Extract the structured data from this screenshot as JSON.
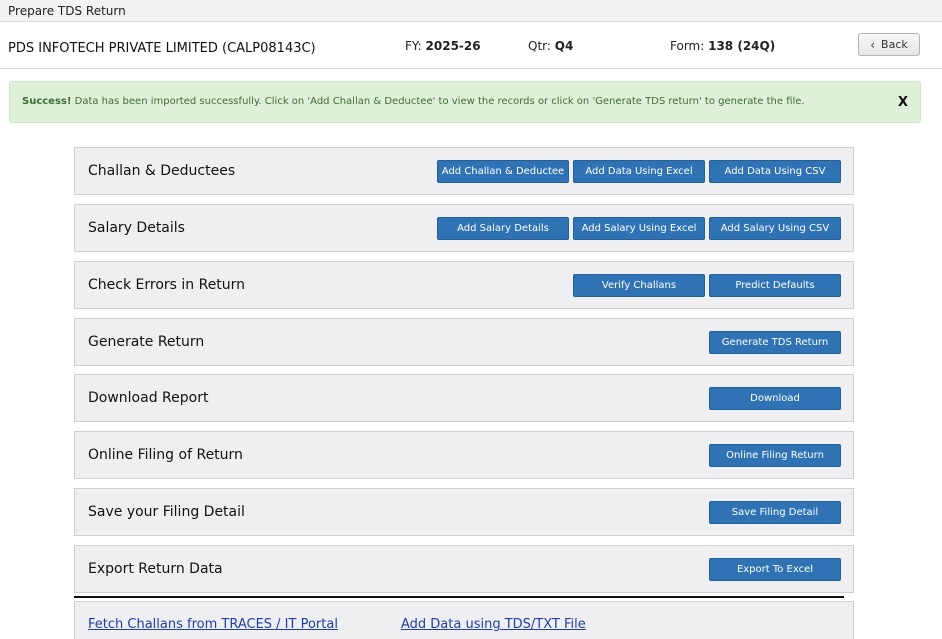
{
  "window": {
    "title": "Prepare TDS Return"
  },
  "header": {
    "company": "PDS INFOTECH PRIVATE LIMITED (CALP08143C)",
    "fy_label": "FY:",
    "fy_value": "2025-26",
    "qtr_label": "Qtr:",
    "qtr_value": "Q4",
    "form_label": "Form:",
    "form_value": "138 (24Q)",
    "back_label": "Back"
  },
  "alert": {
    "strong": "Success!",
    "message": "Data has been imported successfully. Click on 'Add Challan & Deductee' to view the records or click on 'Generate TDS return' to generate the file.",
    "close": "X"
  },
  "sections": [
    {
      "title": "Challan & Deductees",
      "buttons": [
        "Add Challan & Deductee",
        "Add Data Using Excel",
        "Add Data Using CSV"
      ]
    },
    {
      "title": "Salary Details",
      "buttons": [
        "Add Salary Details",
        "Add Salary Using Excel",
        "Add Salary Using CSV"
      ]
    },
    {
      "title": "Check Errors in Return",
      "buttons": [
        "Verify Challans",
        "Predict Defaults"
      ]
    },
    {
      "title": "Generate Return",
      "buttons": [
        "Generate TDS Return"
      ]
    },
    {
      "title": "Download Report",
      "buttons": [
        "Download"
      ]
    },
    {
      "title": "Online Filing of Return",
      "buttons": [
        "Online Filing Return"
      ]
    },
    {
      "title": "Save your Filing Detail",
      "buttons": [
        "Save Filing Detail"
      ]
    },
    {
      "title": "Export Return Data",
      "buttons": [
        "Export To Excel"
      ]
    }
  ],
  "links": {
    "fetch_challans": "Fetch Challans from TRACES / IT Portal",
    "add_tds_txt": "Add Data using TDS/TXT File"
  },
  "colors": {
    "primary_button": "#2f73b5",
    "success_bg": "#dff0d8",
    "panel_bg": "#efeff1",
    "link": "#1f3fa8"
  }
}
